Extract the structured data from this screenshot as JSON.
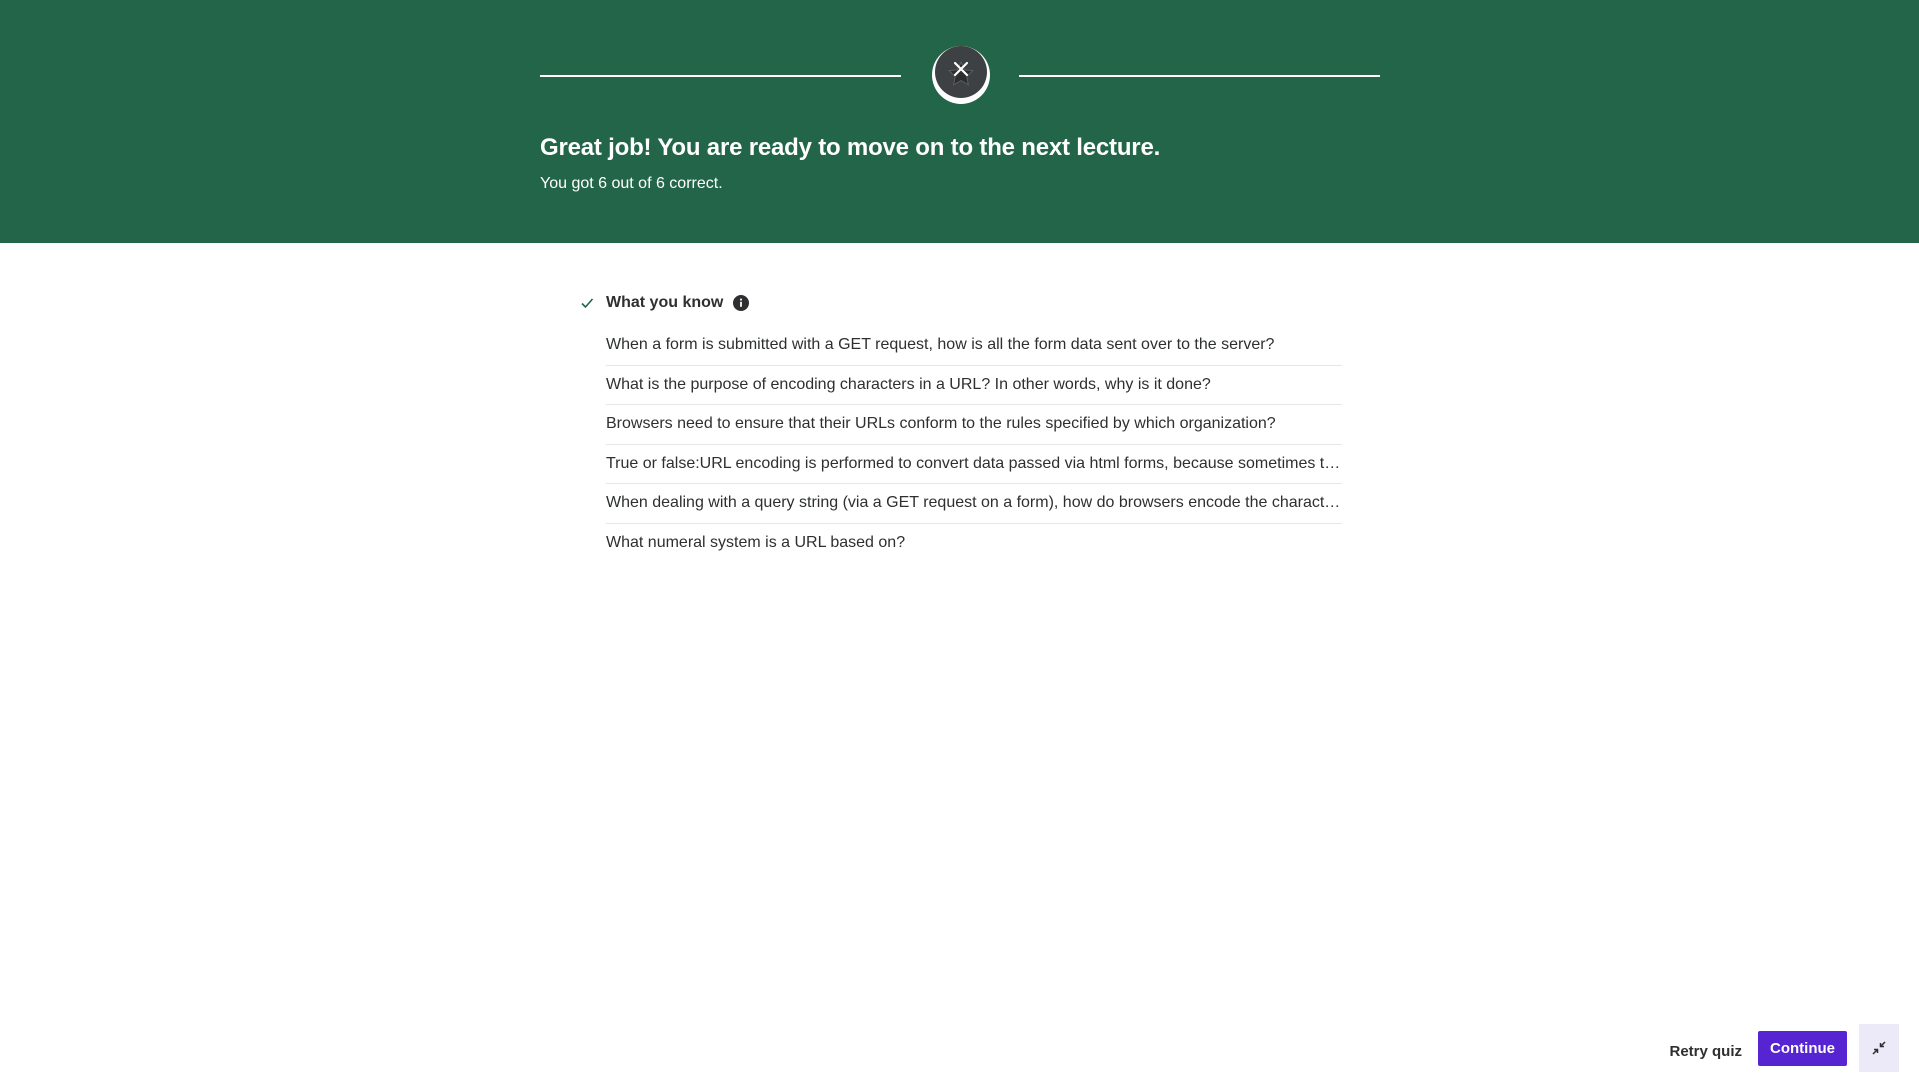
{
  "banner": {
    "title": "Great job! You are ready to move on to the next lecture.",
    "subtitle": "You got 6 out of 6 correct.",
    "background_color": "#226548",
    "badge_icon": "star-icon",
    "close_icon": "close-icon"
  },
  "section": {
    "title": "What you know",
    "status_icon": "check-icon",
    "info_icon": "info-icon",
    "questions": [
      "When a form is submitted with a GET request, how is all the form data sent over to the server?",
      "What is the purpose of encoding characters in a URL? In other words, why is it done?",
      "Browsers need to ensure that their URLs conform to the rules specified by which organization?",
      "True or false:URL encoding is performed to convert data passed via html forms, because sometimes t…",
      "When dealing with a query string (via a GET request on a form), how do browsers encode the characte…",
      "What numeral system is a URL based on?"
    ]
  },
  "footer": {
    "retry_label": "Retry quiz",
    "continue_label": "Continue",
    "collapse_icon": "collapse-icon",
    "accent_color": "#5624d0"
  }
}
